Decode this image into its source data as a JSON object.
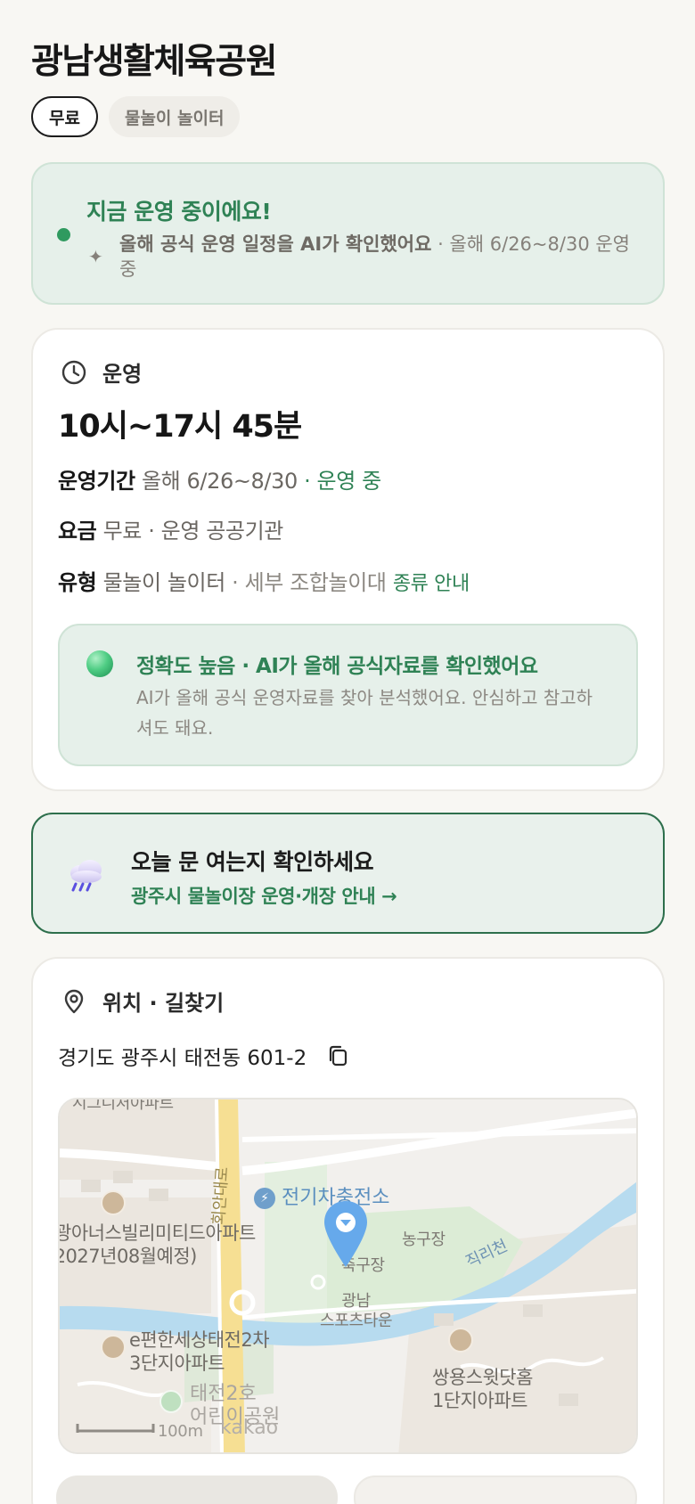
{
  "page": {
    "title": "광남생활체육공원"
  },
  "chips": [
    {
      "label": "무료",
      "active": true
    },
    {
      "label": "물놀이 놀이터",
      "active": false
    }
  ],
  "status": {
    "title": "지금 운영 중이에요!",
    "ai_note": "올해 공식 운영 일정을 AI가 확인했어요",
    "detail": " · 올해 6/26~8/30 운영 중",
    "dot_color": "#2f9a5f"
  },
  "hours": {
    "section_label": "운영",
    "section_icon": "clock-icon",
    "main": "10시~17시 45분",
    "period_key": "운영기간",
    "period_value": "올해 6/26~8/30",
    "period_status": " · 운영 중",
    "fee_key": "요금",
    "fee_value": "무료 · 운영 공공기관",
    "type_key": "유형",
    "type_value": "물놀이 놀이터",
    "type_detail": " · 세부 조합놀이대",
    "type_link": "종류 안내",
    "accuracy": {
      "title": "정확도 높음 · AI가 올해 공식자료를 확인했어요",
      "text": "AI가 올해 공식 운영자료를 찾아 분석했어요. 안심하고 참고하셔도 돼요."
    }
  },
  "notice": {
    "title": "오늘 문 여는지 확인하세요",
    "link": "광주시 물놀이장 운영·개장 안내 →",
    "icon": "rain-cloud-icon"
  },
  "location": {
    "section_label": "위치 · 길찾기",
    "section_icon": "map-pin-icon",
    "address": "경기도 광주시 태전동 601-2",
    "map": {
      "labels": {
        "top_apt": "시그니처아파트",
        "ev": "전기차충전소",
        "apt_left_1": "광아너스빌리미티드아파트",
        "apt_left_2": "(2027년08월예정)",
        "basketball": "농구장",
        "soccer": "축구장",
        "stream": "직리천",
        "sports_town_1": "광남",
        "sports_town_2": "스포츠타운",
        "efeel_1": "e편한세상태전2차",
        "efeel_2": "3단지아파트",
        "ssangyong_1": "쌍용스윗닷홈",
        "ssangyong_2": "1단지아파트",
        "park_1": "태전2호",
        "park_2": "어린이공원",
        "road": "회안대로",
        "scale": "100m",
        "brand": "kakao"
      }
    }
  }
}
